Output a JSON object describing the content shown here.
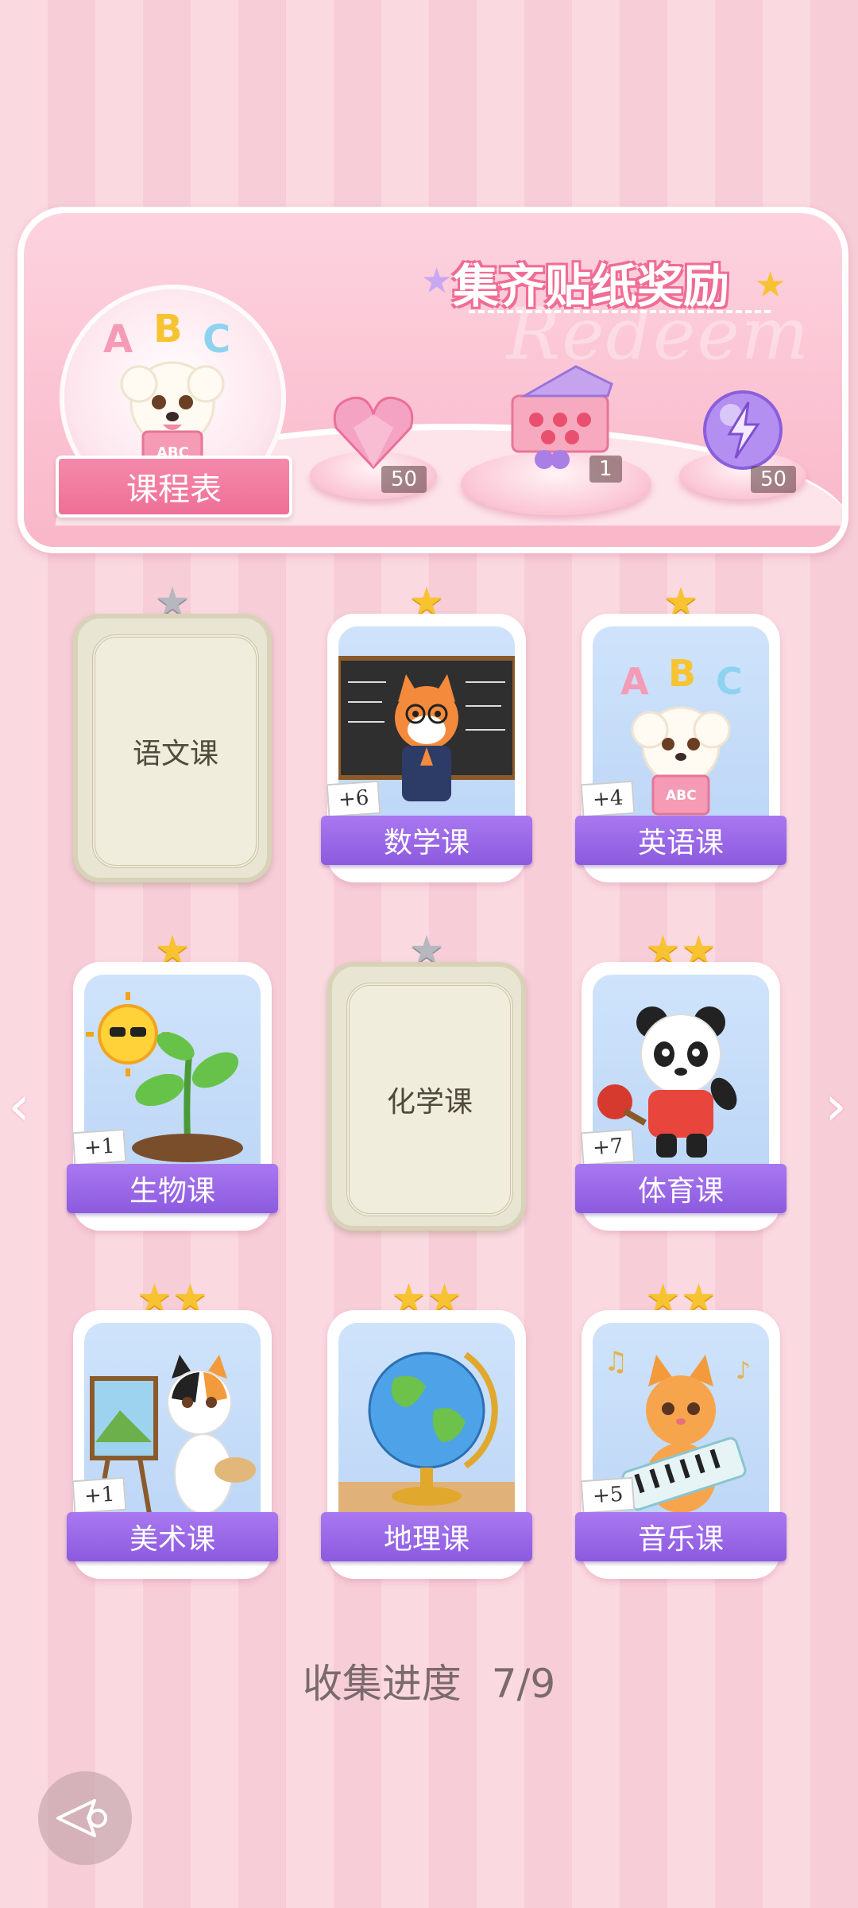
{
  "banner": {
    "title": "集齐贴纸奖励",
    "watermark": "Redeem",
    "schedule_label": "课程表",
    "rewards": [
      {
        "icon": "heart-gem-icon",
        "count": "50"
      },
      {
        "icon": "gift-box-icon",
        "count": "1"
      },
      {
        "icon": "energy-orb-icon",
        "count": "50"
      }
    ]
  },
  "cards": [
    {
      "label": "语文课",
      "stars": 1,
      "earned": false,
      "plus": ""
    },
    {
      "label": "数学课",
      "stars": 1,
      "earned": true,
      "plus": "+6",
      "icon": "fox-teacher-icon"
    },
    {
      "label": "英语课",
      "stars": 1,
      "earned": true,
      "plus": "+4",
      "icon": "puppy-abc-icon"
    },
    {
      "label": "生物课",
      "stars": 1,
      "earned": true,
      "plus": "+1",
      "icon": "sprout-sun-icon"
    },
    {
      "label": "化学课",
      "stars": 1,
      "earned": false,
      "plus": ""
    },
    {
      "label": "体育课",
      "stars": 2,
      "earned": true,
      "plus": "+7",
      "icon": "panda-pingpong-icon"
    },
    {
      "label": "美术课",
      "stars": 2,
      "earned": true,
      "plus": "+1",
      "icon": "cat-painter-icon"
    },
    {
      "label": "地理课",
      "stars": 2,
      "earned": true,
      "plus": "",
      "icon": "globe-icon"
    },
    {
      "label": "音乐课",
      "stars": 2,
      "earned": true,
      "plus": "+5",
      "icon": "cat-keyboard-icon"
    }
  ],
  "progress": {
    "label": "收集进度",
    "value": "7/9"
  },
  "colors": {
    "accent": "#8c5ade",
    "pink": "#f06c94",
    "star": "#f7c331"
  }
}
